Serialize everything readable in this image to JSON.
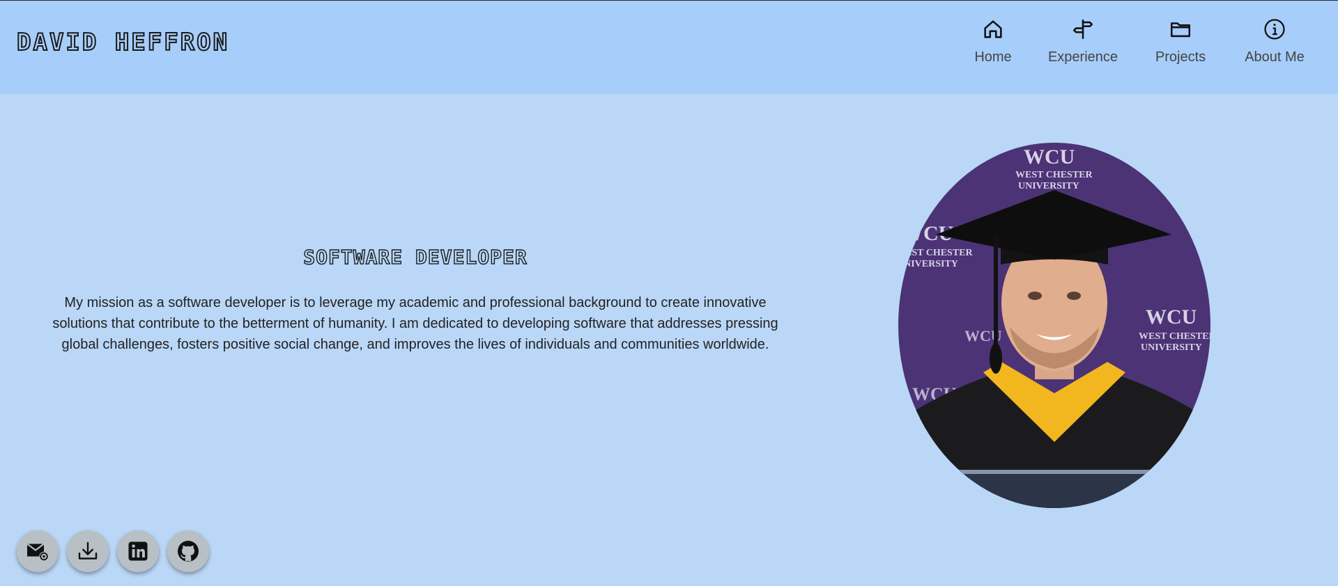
{
  "header": {
    "brand": "DAVID HEFFRON",
    "nav": [
      {
        "label": "Home",
        "icon": "home-icon"
      },
      {
        "label": "Experience",
        "icon": "signpost-icon"
      },
      {
        "label": "Projects",
        "icon": "folder-icon"
      },
      {
        "label": "About Me",
        "icon": "info-icon"
      }
    ]
  },
  "main": {
    "title": "SOFTWARE DEVELOPER",
    "mission": "My mission as a software developer is to leverage my academic and professional background to create innovative solutions that contribute to the betterment of humanity. I am dedicated to developing software that addresses pressing global challenges, fosters positive social change, and improves the lives of individuals and communities worldwide."
  },
  "portrait": {
    "backdrop_texts": [
      "WCU",
      "WEST CHESTER",
      "UNIVERSITY"
    ]
  },
  "social": [
    {
      "icon": "email-icon"
    },
    {
      "icon": "download-icon"
    },
    {
      "icon": "linkedin-icon"
    },
    {
      "icon": "github-icon"
    }
  ],
  "colors": {
    "header_bg": "#a7cdfa",
    "page_bg": "#bad7f7",
    "backdrop_purple": "#4b3375",
    "hood_gold": "#f2b71e",
    "button_bg": "#b8c0c6"
  }
}
